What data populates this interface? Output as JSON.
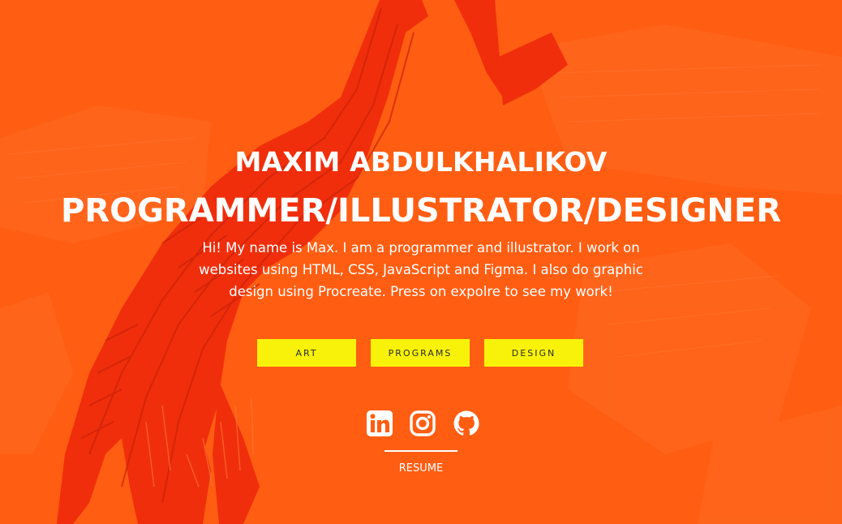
{
  "hero": {
    "name": "MAXIM ABDULKHALIKOV",
    "roles": "PROGRAMMER/ILLUSTRATOR/DESIGNER",
    "intro": "Hi! My name is Max. I am a programmer and illustrator. I work on websites using HTML, CSS, JavaScript and Figma. I also do graphic design using Procreate. Press on expolre to see my work!"
  },
  "buttons": {
    "art": "ART",
    "programs": "PROGRAMS",
    "design": "DESIGN"
  },
  "social": {
    "icons": [
      "linkedin-icon",
      "instagram-icon",
      "github-icon"
    ]
  },
  "resume": {
    "label": "RESUME"
  },
  "colors": {
    "background": "#ff5d12",
    "artwork": "#f02e0c",
    "button": "#f8f20b",
    "text": "#ffffff"
  }
}
